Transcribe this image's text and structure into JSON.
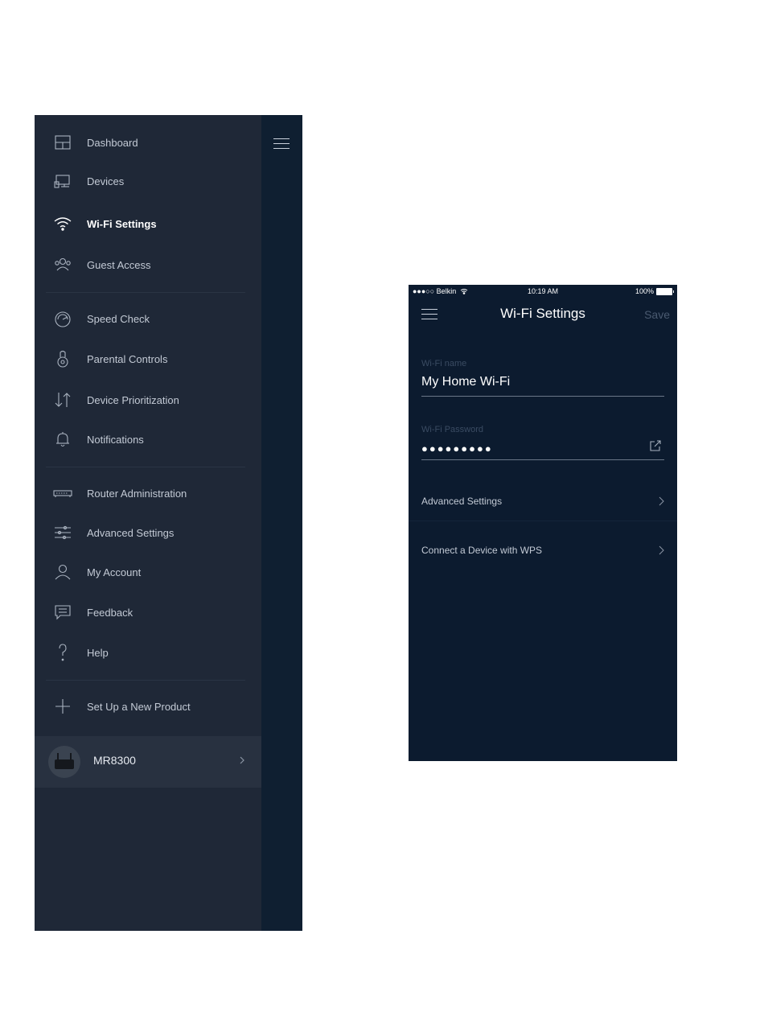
{
  "menu": {
    "items": [
      {
        "label": "Dashboard",
        "icon": "dashboard-icon"
      },
      {
        "label": "Devices",
        "icon": "devices-icon"
      },
      {
        "label": "Wi-Fi Settings",
        "icon": "wifi-icon",
        "active": true
      },
      {
        "label": "Guest Access",
        "icon": "guest-access-icon"
      },
      {
        "label": "Speed Check",
        "icon": "speedometer-icon"
      },
      {
        "label": "Parental Controls",
        "icon": "parental-controls-icon"
      },
      {
        "label": "Device Prioritization",
        "icon": "prioritization-arrows-icon"
      },
      {
        "label": "Notifications",
        "icon": "bell-icon"
      },
      {
        "label": "Router Administration",
        "icon": "router-icon"
      },
      {
        "label": "Advanced Settings",
        "icon": "sliders-icon"
      },
      {
        "label": "My Account",
        "icon": "user-icon"
      },
      {
        "label": "Feedback",
        "icon": "feedback-icon"
      },
      {
        "label": "Help",
        "icon": "help-icon"
      },
      {
        "label": "Set Up a New Product",
        "icon": "plus-icon"
      }
    ],
    "device": {
      "name": "MR8300"
    }
  },
  "wifi_screen": {
    "status": {
      "carrier": "●●●○○ Belkin",
      "time": "10:19 AM",
      "battery": "100%"
    },
    "title": "Wi-Fi Settings",
    "save_label": "Save",
    "wifi_name_label": "Wi-Fi name",
    "wifi_name_value": "My Home Wi-Fi",
    "wifi_password_label": "Wi-Fi Password",
    "wifi_password_value": "●●●●●●●●●",
    "rows": [
      {
        "label": "Advanced Settings"
      },
      {
        "label": "Connect a Device with WPS"
      }
    ]
  }
}
